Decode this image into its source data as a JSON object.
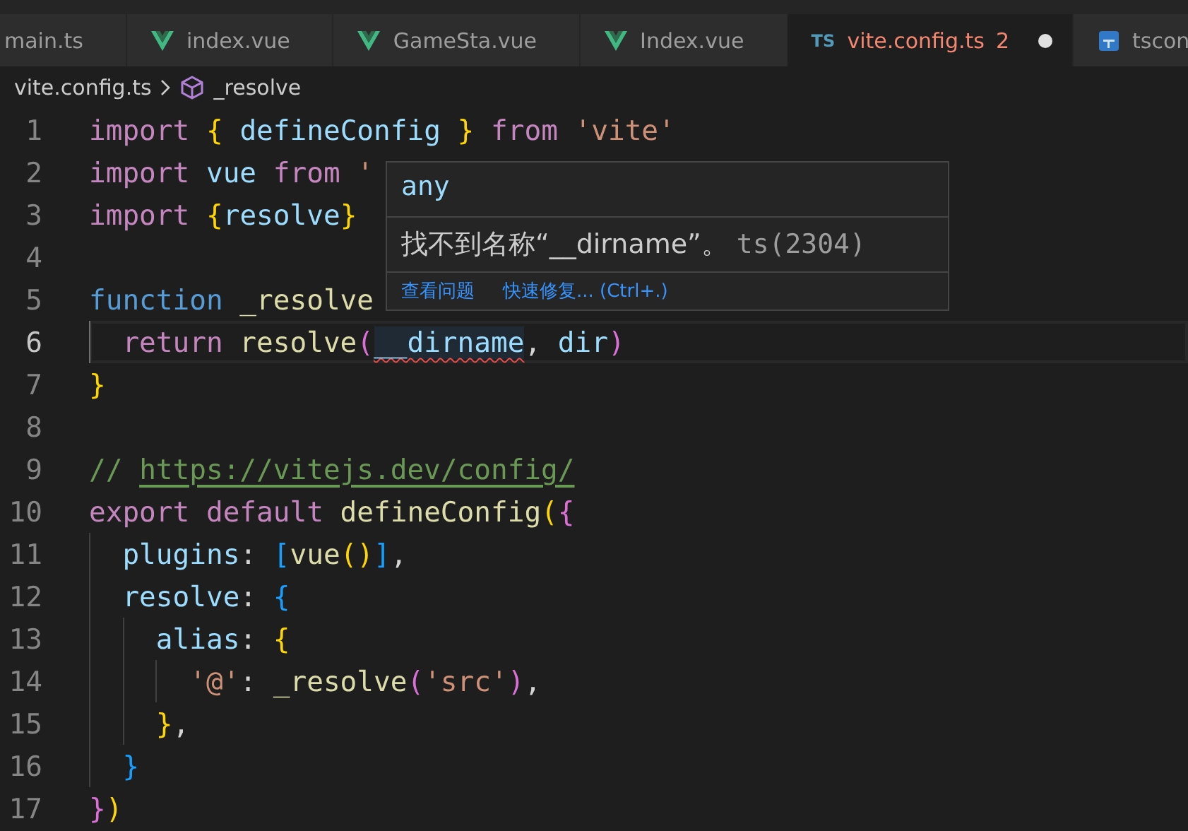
{
  "tabs": [
    {
      "label": "main.ts",
      "kind": "plain",
      "selected": false,
      "modified": false
    },
    {
      "label": "index.vue",
      "kind": "vue",
      "selected": false,
      "modified": false
    },
    {
      "label": "GameSta.vue",
      "kind": "vue",
      "selected": false,
      "modified": false
    },
    {
      "label": "Index.vue",
      "kind": "vue",
      "selected": false,
      "modified": false
    },
    {
      "label": "vite.config.ts",
      "kind": "ts",
      "badge": "TS",
      "selected": true,
      "modified": true,
      "problems": "2"
    },
    {
      "label": "tscon",
      "kind": "config",
      "selected": false,
      "modified": false
    }
  ],
  "breadcrumb": {
    "file": "vite.config.ts",
    "symbol": "_resolve"
  },
  "lines": [
    {
      "number": "1",
      "current": false,
      "tokens": [
        {
          "kind": "kw",
          "text": "import"
        },
        {
          "kind": "b1",
          "text": " {"
        },
        {
          "kind": "var",
          "text": " defineConfig "
        },
        {
          "kind": "b1",
          "text": "}"
        },
        {
          "kind": "kw",
          "text": " from"
        },
        {
          "kind": "str",
          "text": " 'vite'"
        }
      ]
    },
    {
      "number": "2",
      "current": false,
      "tokens": [
        {
          "kind": "kw",
          "text": "import"
        },
        {
          "kind": "var",
          "text": " vue "
        },
        {
          "kind": "kw",
          "text": "from"
        },
        {
          "kind": "str",
          "text": " '"
        }
      ]
    },
    {
      "number": "3",
      "current": false,
      "tokens": [
        {
          "kind": "kw",
          "text": "import"
        },
        {
          "kind": "b1",
          "text": " {"
        },
        {
          "kind": "var",
          "text": "resolve"
        },
        {
          "kind": "b1",
          "text": "}"
        }
      ]
    },
    {
      "number": "4",
      "current": false
    },
    {
      "number": "5",
      "current": false,
      "tokens": [
        {
          "kind": "decl",
          "text": "function"
        },
        {
          "kind": "fn",
          "text": " _resolve"
        }
      ]
    },
    {
      "number": "6",
      "current": true,
      "tokens": [
        {
          "kind": "kw",
          "text": "  return"
        },
        {
          "kind": "fn",
          "text": " resolve"
        },
        {
          "kind": "b2",
          "text": "("
        },
        {
          "kind": "error",
          "text": "__dirname"
        },
        {
          "kind": "plain",
          "text": ","
        },
        {
          "kind": "var",
          "text": " dir"
        },
        {
          "kind": "b2",
          "text": ")"
        }
      ]
    },
    {
      "number": "7",
      "current": false,
      "tokens": [
        {
          "kind": "b1",
          "text": "}"
        }
      ]
    },
    {
      "number": "8",
      "current": false
    },
    {
      "number": "9",
      "current": false,
      "tokens": [
        {
          "kind": "comment",
          "text": "//"
        },
        {
          "kind": "link",
          "text": "https://vitejs.dev/config/"
        }
      ]
    },
    {
      "number": "10",
      "current": false,
      "tokens": [
        {
          "kind": "kw",
          "text": "export"
        },
        {
          "kind": "kw",
          "text": " default"
        },
        {
          "kind": "fn",
          "text": " defineConfig"
        },
        {
          "kind": "b1",
          "text": "("
        },
        {
          "kind": "b2",
          "text": "{"
        }
      ]
    },
    {
      "number": "11",
      "current": false,
      "tokens": [
        {
          "kind": "var",
          "text": "  plugins"
        },
        {
          "kind": "plain",
          "text": ":"
        },
        {
          "kind": "b3",
          "text": " ["
        },
        {
          "kind": "fn",
          "text": "vue"
        },
        {
          "kind": "b1",
          "text": "()"
        },
        {
          "kind": "b3",
          "text": "]"
        },
        {
          "kind": "plain",
          "text": ","
        }
      ]
    },
    {
      "number": "12",
      "current": false,
      "tokens": [
        {
          "kind": "var",
          "text": "  resolve"
        },
        {
          "kind": "plain",
          "text": ":"
        },
        {
          "kind": "b3",
          "text": " {"
        }
      ]
    },
    {
      "number": "13",
      "current": false,
      "tokens": [
        {
          "kind": "var",
          "text": "    alias"
        },
        {
          "kind": "plain",
          "text": ":"
        },
        {
          "kind": "b1",
          "text": " {"
        }
      ]
    },
    {
      "number": "14",
      "current": false,
      "tokens": [
        {
          "kind": "str",
          "text": "      '@'"
        },
        {
          "kind": "plain",
          "text": ":"
        },
        {
          "kind": "fn",
          "text": " _resolve"
        },
        {
          "kind": "b2",
          "text": "("
        },
        {
          "kind": "str",
          "text": "'src'"
        },
        {
          "kind": "b2",
          "text": ")"
        },
        {
          "kind": "plain",
          "text": ","
        }
      ]
    },
    {
      "number": "15",
      "current": false,
      "tokens": [
        {
          "kind": "b1",
          "text": "    }"
        },
        {
          "kind": "plain",
          "text": ","
        }
      ]
    },
    {
      "number": "16",
      "current": false,
      "tokens": [
        {
          "kind": "b3",
          "text": "  }"
        }
      ]
    },
    {
      "number": "17",
      "current": false,
      "tokens": [
        {
          "kind": "b2",
          "text": "}"
        },
        {
          "kind": "b1",
          "text": ")"
        }
      ]
    }
  ],
  "hover": {
    "type": "any",
    "message": "找不到名称“__dirname”。",
    "code": "ts(2304)",
    "actions": [
      "查看问题",
      "快速修复... (Ctrl+.)"
    ]
  }
}
